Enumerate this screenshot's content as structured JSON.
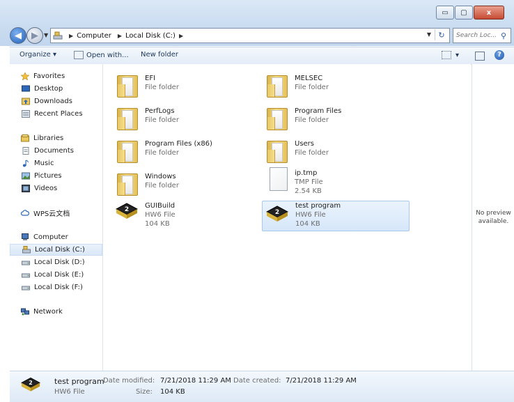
{
  "window": {
    "controls": {
      "minimize": "▭",
      "maximize": "▢",
      "close": "x"
    }
  },
  "nav": {
    "back_glyph": "◀",
    "forward_glyph": "▶",
    "dropdown_glyph": "▼",
    "breadcrumb": [
      "Computer",
      "Local Disk (C:)"
    ],
    "breadcrumb_sep": "▶",
    "refresh_glyph": "↻",
    "search_placeholder": "Search Loc...",
    "search_glyph": "⚲"
  },
  "toolbar": {
    "organize": "Organize ▾",
    "open_with": "Open with...",
    "new_folder": "New folder",
    "views_glyph": "▾",
    "help": "?"
  },
  "sidebar": {
    "favorites": {
      "label": "Favorites",
      "items": [
        "Desktop",
        "Downloads",
        "Recent Places"
      ]
    },
    "libraries": {
      "label": "Libraries",
      "items": [
        "Documents",
        "Music",
        "Pictures",
        "Videos"
      ]
    },
    "wps": {
      "label": "WPS云文档"
    },
    "computer": {
      "label": "Computer",
      "items": [
        "Local Disk (C:)",
        "Local Disk (D:)",
        "Local Disk (E:)",
        "Local Disk (F:)"
      ]
    },
    "network": {
      "label": "Network"
    }
  },
  "files": [
    {
      "name": "EFI",
      "type": "File folder",
      "size": "",
      "icon": "folder-icon"
    },
    {
      "name": "MELSEC",
      "type": "File folder",
      "size": "",
      "icon": "folder-icon"
    },
    {
      "name": "PerfLogs",
      "type": "File folder",
      "size": "",
      "icon": "folder-icon"
    },
    {
      "name": "Program Files",
      "type": "File folder",
      "size": "",
      "icon": "folder-icon"
    },
    {
      "name": "Program Files (x86)",
      "type": "File folder",
      "size": "",
      "icon": "folder-icon"
    },
    {
      "name": "Users",
      "type": "File folder",
      "size": "",
      "icon": "folder-icon"
    },
    {
      "name": "Windows",
      "type": "File folder",
      "size": "",
      "icon": "folder-icon"
    },
    {
      "name": "ip.tmp",
      "type": "TMP File",
      "size": "2.54 KB",
      "icon": "document-icon"
    },
    {
      "name": "GUIBuild",
      "type": "HW6 File",
      "size": "104 KB",
      "icon": "hw6-chip-icon"
    },
    {
      "name": "test program",
      "type": "HW6 File",
      "size": "104 KB",
      "icon": "hw6-chip-icon"
    }
  ],
  "preview": {
    "message": "No preview available."
  },
  "details": {
    "name": "test program",
    "type": "HW6 File",
    "modified_label": "Date modified:",
    "modified_value": "7/21/2018 11:29 AM",
    "created_label": "Date created:",
    "created_value": "7/21/2018 11:29 AM",
    "size_label": "Size:",
    "size_value": "104 KB"
  },
  "colors": {
    "accent": "#2c5aa0",
    "selection": "#d6e7fa",
    "chrome": "#c9dcf0"
  }
}
